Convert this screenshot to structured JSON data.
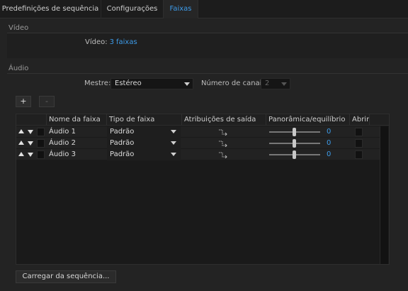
{
  "tabs": [
    {
      "label": "Predefinições de sequência"
    },
    {
      "label": "Configurações"
    },
    {
      "label": "Faixas",
      "active": true
    }
  ],
  "video": {
    "section_title": "Vídeo",
    "label": "Vídeo:",
    "count": "3",
    "unit": "faixas"
  },
  "audio": {
    "section_title": "Áudio",
    "master_label": "Mestre:",
    "master_value": "Estéreo",
    "channels_label": "Número de canais:",
    "channels_value": "2",
    "add_label": "+",
    "remove_label": "-",
    "columns": [
      "Nome da faixa",
      "Tipo de faixa",
      "Atribuições de saída",
      "Panorâmica/equilíbrio",
      "Abrir"
    ],
    "tracks": [
      {
        "name": "Áudio 1",
        "type": "Padrão",
        "pan": "0"
      },
      {
        "name": "Áudio 2",
        "type": "Padrão",
        "pan": "0"
      },
      {
        "name": "Áudio 3",
        "type": "Padrão",
        "pan": "0"
      }
    ],
    "load_button": "Carregar da sequência..."
  },
  "colors": {
    "accent": "#3d9be9",
    "background": "#232323"
  },
  "icons": {
    "route": "output-routing-icon",
    "move_up": "move-up-icon",
    "move_down": "move-down-icon"
  }
}
